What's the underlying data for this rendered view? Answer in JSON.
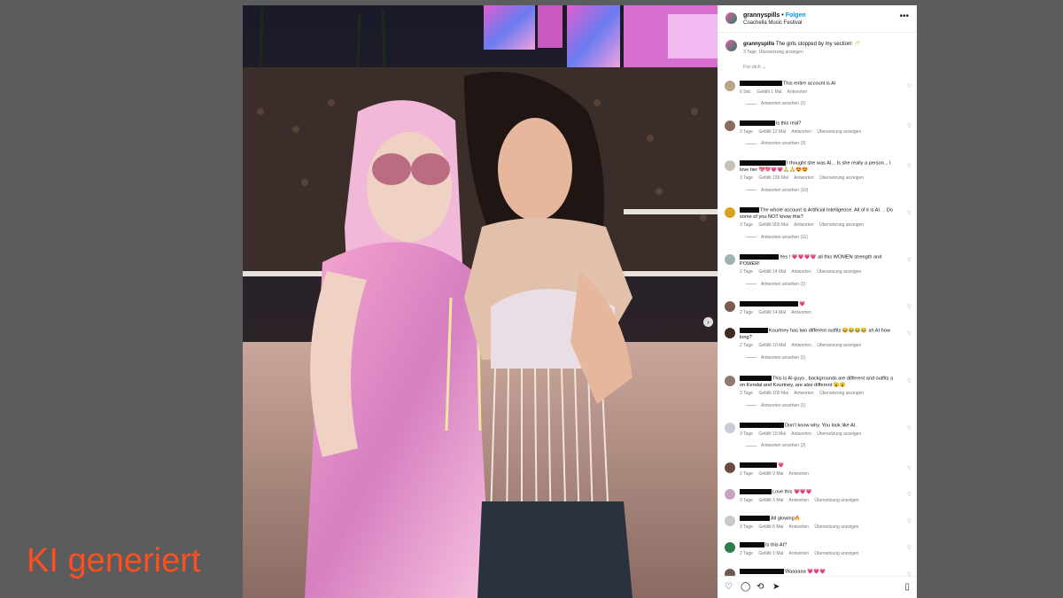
{
  "watermark": "KI generiert",
  "post": {
    "username": "grannyspills",
    "follow_label": "Folgen",
    "location": "Coachella Music Festival",
    "caption_user": "grannyspills",
    "caption_text": "The girls stopped by my section! 🥂",
    "caption_age": "3 Tage",
    "translate_label": "Übersetzung anzeigen",
    "sort_label": "Für dich"
  },
  "comments": [
    {
      "redact": 48,
      "text": "This entire account is AI",
      "age": "6 Std.",
      "likes": "Gefällt 1 Mal",
      "reply": "Antworten",
      "translate": "",
      "replies": "Antworten ansehen (1)",
      "avatar": "#b9a58a"
    },
    {
      "redact": 40,
      "text": "is this real?",
      "age": "3 Tage",
      "likes": "Gefällt 12 Mal",
      "reply": "Antworten",
      "translate": "Übersetzung anzeigen",
      "replies": "Antworten ansehen (3)",
      "avatar": "#8a6c5c"
    },
    {
      "redact": 52,
      "text": "I thought she was AI... Is she really a person... I love her 💖💖💗💗🙏🙏😍😍",
      "age": "3 Tage",
      "likes": "Gefällt 196 Mal",
      "reply": "Antworten",
      "translate": "Übersetzung anzeigen",
      "replies": "Antworten ansehen (10)",
      "avatar": "#c9c1b8"
    },
    {
      "redact": 22,
      "text": "The whole account is Artificial Intelligence. All of it is AI. .. Do some of you NOT know this?",
      "age": "3 Tage",
      "likes": "Gefällt 900 Mal",
      "reply": "Antworten",
      "translate": "Übersetzung anzeigen",
      "replies": "Antworten ansehen (11)",
      "avatar": "#d8a21e"
    },
    {
      "redact": 44,
      "text": "Yes ! 💗💗💗💗 all this WOMEN strength and POWER!",
      "age": "2 Tage",
      "likes": "Gefällt 14 Mal",
      "reply": "Antworten",
      "translate": "Übersetzung anzeigen",
      "replies": "Antworten ansehen (1)",
      "avatar": "#9fb4b0"
    },
    {
      "redact": 66,
      "text": "💗",
      "age": "2 Tage",
      "likes": "Gefällt 14 Mal",
      "reply": "Antworten",
      "translate": "",
      "replies": "",
      "avatar": "#7a5a4c"
    },
    {
      "redact": 32,
      "text": "Kourtney has two different outfits 😂😂😂😂 ah AI how long?",
      "age": "2 Tage",
      "likes": "Gefällt 10 Mal",
      "reply": "Antworten",
      "translate": "Übersetzung anzeigen",
      "replies": "Antworten ansehen (1)",
      "avatar": "#3a2a22"
    },
    {
      "redact": 36,
      "text": "This is AI guys , backgrounds are different and outfits a on Kendal and Kourtney, are also different 😮😮",
      "age": "3 Tage",
      "likes": "Gefällt 100 Mal",
      "reply": "Antworten",
      "translate": "Übersetzung anzeigen",
      "replies": "Antworten ansehen (1)",
      "avatar": "#8e7a70"
    },
    {
      "redact": 50,
      "text": "Don't know why. You look like AI.",
      "age": "3 Tage",
      "likes": "Gefällt 15 Mal",
      "reply": "Antworten",
      "translate": "Übersetzung anzeigen",
      "replies": "Antworten ansehen (2)",
      "avatar": "#c7cdd6"
    },
    {
      "redact": 42,
      "text": "💗",
      "age": "2 Tage",
      "likes": "Gefällt 9 Mal",
      "reply": "Antworten",
      "translate": "",
      "replies": "",
      "avatar": "#6b4a3f"
    },
    {
      "redact": 36,
      "text": "Love this 💗💗💗",
      "age": "3 Tage",
      "likes": "Gefällt 3 Mal",
      "reply": "Antworten",
      "translate": "Übersetzung anzeigen",
      "replies": "",
      "avatar": "#c7a3c2"
    },
    {
      "redact": 34,
      "text": "All glowing🔥",
      "age": "3 Tage",
      "likes": "Gefällt 6 Mal",
      "reply": "Antworten",
      "translate": "Übersetzung anzeigen",
      "replies": "",
      "avatar": "#c8c8c8"
    },
    {
      "redact": 28,
      "text": "Is this AI?",
      "age": "2 Tage",
      "likes": "Gefällt 1 Mal",
      "reply": "Antworten",
      "translate": "Übersetzung anzeigen",
      "replies": "",
      "avatar": "#2f7d4f"
    },
    {
      "redact": 50,
      "text": "Waaaaaa 💗💗💗",
      "age": "",
      "likes": "",
      "reply": "",
      "translate": "",
      "replies": "",
      "avatar": "#6d5a50"
    }
  ],
  "icons": [
    "heart-icon",
    "comment-icon",
    "repost-icon",
    "share-icon",
    "bookmark-icon"
  ]
}
